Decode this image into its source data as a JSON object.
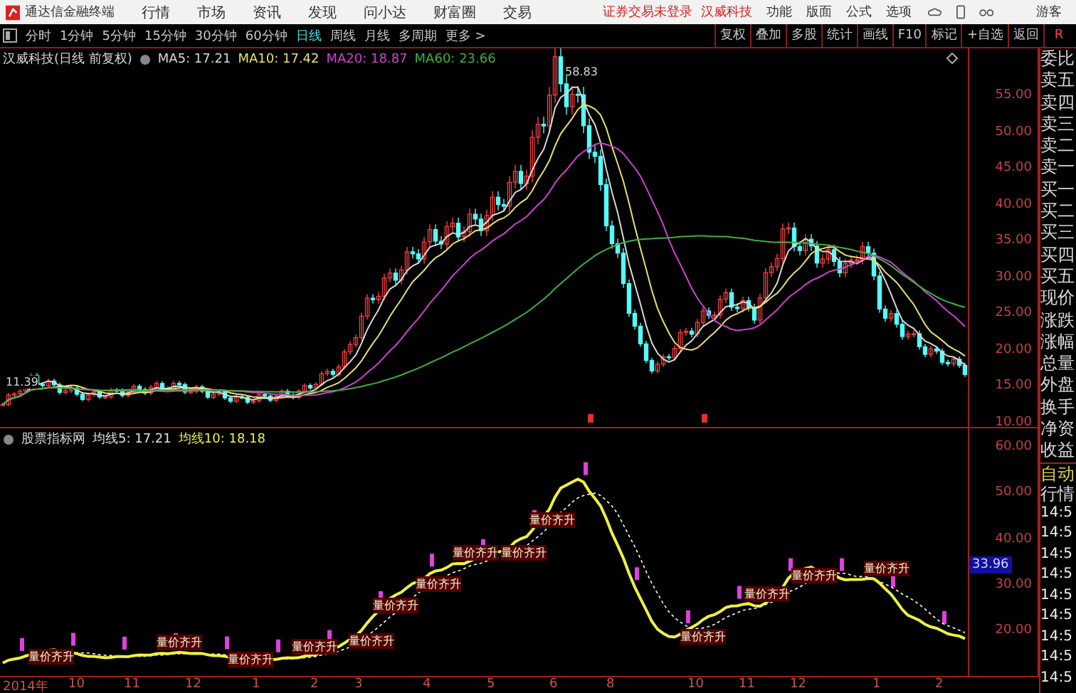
{
  "menubar": {
    "app_title": "通达信金融终端",
    "menu": [
      "行情",
      "市场",
      "资讯",
      "发现",
      "问小达",
      "财富圈",
      "交易"
    ],
    "login_notice": "证券交易未登录",
    "stock_name": "汉威科技",
    "right_menu": [
      "功能",
      "版面",
      "公式",
      "选项"
    ],
    "user": "游客"
  },
  "toolbar": {
    "periods": [
      {
        "label": "分时",
        "selected": false
      },
      {
        "label": "1分钟",
        "selected": false
      },
      {
        "label": "5分钟",
        "selected": false
      },
      {
        "label": "15分钟",
        "selected": false
      },
      {
        "label": "30分钟",
        "selected": false
      },
      {
        "label": "60分钟",
        "selected": false
      },
      {
        "label": "日线",
        "selected": true
      },
      {
        "label": "周线",
        "selected": false
      },
      {
        "label": "月线",
        "selected": false
      },
      {
        "label": "多周期",
        "selected": false
      },
      {
        "label": "更多 >",
        "selected": false
      }
    ],
    "tools": [
      "复权",
      "叠加",
      "多股",
      "统计",
      "画线",
      "F10",
      "标记",
      "+自选",
      "返回"
    ],
    "corner": "R"
  },
  "main_chart": {
    "title": "汉威科技(日线 前复权)",
    "ma": [
      {
        "label": "MA5: 17.21",
        "color": "#d8d8d8"
      },
      {
        "label": "MA10: 17.42",
        "color": "#e8e070"
      },
      {
        "label": "MA20: 18.87",
        "color": "#d040d0"
      },
      {
        "label": "MA60: 23.66",
        "color": "#40b040"
      }
    ],
    "peak_label": "58.83",
    "low_label": "11.39",
    "yticks": [
      "55.00",
      "50.00",
      "45.00",
      "40.00",
      "35.00",
      "30.00",
      "25.00",
      "20.00",
      "15.00",
      "10.00"
    ]
  },
  "indicator": {
    "title": "股票指标网",
    "legend": [
      {
        "label": "均线5: 17.21",
        "color": "#e0e0e0"
      },
      {
        "label": "均线10: 18.18",
        "color": "#f0f040"
      }
    ],
    "yticks": [
      "60.00",
      "50.00",
      "40.00",
      "30.00",
      "20.00"
    ],
    "current": "33.96",
    "signals": [
      "量价齐升",
      "量价齐升",
      "量价齐升",
      "量价齐升",
      "量价齐升",
      "量价齐升",
      "量价齐升",
      "量价齐升",
      "量价齐升",
      "量价齐升",
      "量价齐升",
      "量价齐升",
      "量价齐升",
      "量价齐升"
    ]
  },
  "xaxis": [
    "2014年",
    "10",
    "11",
    "12",
    "1",
    "2",
    "3",
    "4",
    "5",
    "6",
    "8",
    "10",
    "11",
    "12",
    "1",
    "2"
  ],
  "quote_panel": {
    "labels": [
      "委比",
      "卖五",
      "卖四",
      "卖三",
      "卖二",
      "卖一",
      "买一",
      "买二",
      "买三",
      "买四",
      "买五",
      "现价",
      "涨跌",
      "涨幅",
      "总量",
      "外盘",
      "换手",
      "净资",
      "收益"
    ],
    "auto": "自动",
    "market": "行情",
    "times": [
      "14:5",
      "14:5",
      "14:5",
      "14:5",
      "14:5",
      "14:5",
      "14:5",
      "14:5",
      "14:5"
    ]
  }
}
